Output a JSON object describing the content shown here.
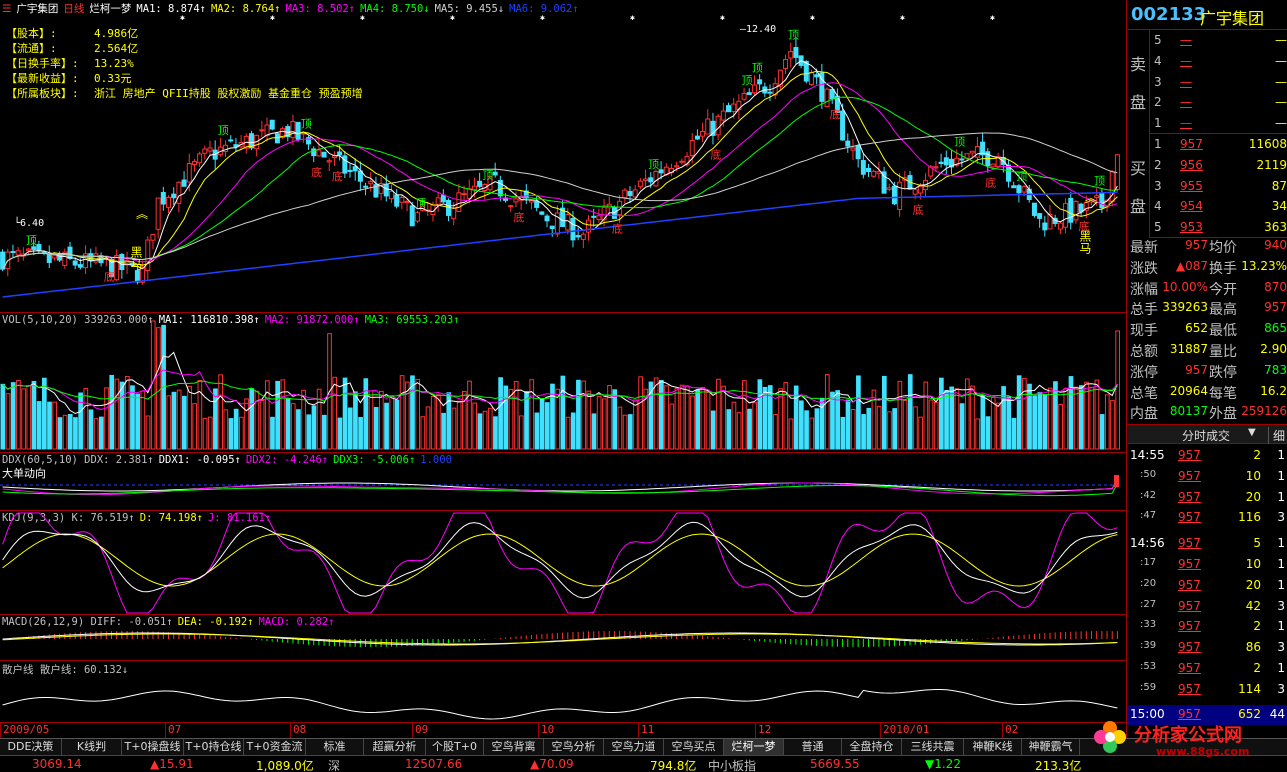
{
  "header": {
    "stock_name": "广宇集团",
    "period": "日线",
    "formula": "烂柯一梦",
    "ma_items": [
      {
        "label": "MA1: 8.874↑",
        "color": "#ffffff"
      },
      {
        "label": "MA2: 8.764↑",
        "color": "#ffff00"
      },
      {
        "label": "MA3: 8.502↑",
        "color": "#ff00ff"
      },
      {
        "label": "MA4: 8.750↓",
        "color": "#00ff00"
      },
      {
        "label": "MA5: 9.455↓",
        "color": "#d0d0d0"
      },
      {
        "label": "MA6: 9.062↑",
        "color": "#2040ff"
      }
    ]
  },
  "info_box": [
    {
      "label": "【股本】:",
      "value": "4.986亿"
    },
    {
      "label": "【流通】:",
      "value": "2.564亿"
    },
    {
      "label": "【日换手率】:",
      "value": "13.23%"
    },
    {
      "label": "【最新收益】:",
      "value": "0.33元"
    },
    {
      "label": "【所属板块】:",
      "value": "浙江  房地产  QFII持股  股权激励  基金重仓  预盈预增"
    }
  ],
  "price_labels": {
    "high": "12.40",
    "low": "6.40",
    "top": "顶",
    "bottom": "底",
    "dark_horse": "黑马"
  },
  "vol_header": [
    {
      "label": "VOL(5,10,20)  339263.000↑",
      "color": "#c0c0c0"
    },
    {
      "label": "MA1: 116810.398↑",
      "color": "#ffffff"
    },
    {
      "label": "MA2: 91872.000↑",
      "color": "#ff00ff"
    },
    {
      "label": "MA3: 69553.203↑",
      "color": "#00ff00"
    }
  ],
  "ddx_header": [
    {
      "label": "DDX(60,5,10)  DDX: 2.381↑",
      "color": "#c0c0c0"
    },
    {
      "label": "DDX1: -0.095↑",
      "color": "#ffffff"
    },
    {
      "label": "DDX2: -4.246↑",
      "color": "#ff00ff"
    },
    {
      "label": "DDX3: -5.006↑",
      "color": "#00ff00"
    },
    {
      "label": "1.000",
      "color": "#2040ff"
    }
  ],
  "ddx_note": "大单动向",
  "kdj_header": [
    {
      "label": "KDJ(9,3,3)  K: 76.519↑",
      "color": "#c0c0c0"
    },
    {
      "label": "D: 74.198↑",
      "color": "#ffff00"
    },
    {
      "label": "J: 81.161↑",
      "color": "#ff00ff"
    }
  ],
  "macd_header": [
    {
      "label": "MACD(26,12,9)  DIFF: -0.051↑",
      "color": "#c0c0c0"
    },
    {
      "label": "DEA: -0.192↑",
      "color": "#ffff00"
    },
    {
      "label": "MACD: 0.282↑",
      "color": "#ff00ff"
    }
  ],
  "sanhu_header": [
    {
      "label": "散户线  散户线: 60.132↓",
      "color": "#c0c0c0"
    }
  ],
  "months": [
    "2009/05",
    "07",
    "08",
    "09",
    "10",
    "11",
    "12",
    "2010/01",
    "02"
  ],
  "quote": {
    "code": "002133",
    "name": "广宇集团",
    "sell_label": "卖盘",
    "buy_label": "买盘",
    "asks": [
      {
        "n": "5",
        "p": "—",
        "v": "—"
      },
      {
        "n": "4",
        "p": "—",
        "v": "—"
      },
      {
        "n": "3",
        "p": "—",
        "v": "—"
      },
      {
        "n": "2",
        "p": "—",
        "v": "—"
      },
      {
        "n": "1",
        "p": "—",
        "v": "—"
      }
    ],
    "bids": [
      {
        "n": "1",
        "p": "957",
        "v": "11608"
      },
      {
        "n": "2",
        "p": "956",
        "v": "2119"
      },
      {
        "n": "3",
        "p": "955",
        "v": "87"
      },
      {
        "n": "4",
        "p": "954",
        "v": "34"
      },
      {
        "n": "5",
        "p": "953",
        "v": "363"
      }
    ],
    "stats": [
      {
        "l1": "最新",
        "v1": "957",
        "c1": "#ff3030",
        "l2": "均价",
        "v2": "940",
        "c2": "#ff3030"
      },
      {
        "l1": "涨跌",
        "v1": "▲087",
        "c1": "#ff3030",
        "l2": "换手",
        "v2": "13.23%",
        "c2": "#ffff00"
      },
      {
        "l1": "涨幅",
        "v1": "10.00%",
        "c1": "#ff3030",
        "l2": "今开",
        "v2": "870",
        "c2": "#ff3030"
      },
      {
        "l1": "总手",
        "v1": "339263",
        "c1": "#ffff00",
        "l2": "最高",
        "v2": "957",
        "c2": "#ff3030"
      },
      {
        "l1": "现手",
        "v1": "652",
        "c1": "#ffff00",
        "l2": "最低",
        "v2": "865",
        "c2": "#00ff00"
      },
      {
        "l1": "总额",
        "v1": "31887",
        "c1": "#ffff00",
        "l2": "量比",
        "v2": "2.90",
        "c2": "#ffff00"
      },
      {
        "l1": "涨停",
        "v1": "957",
        "c1": "#ff3030",
        "l2": "跌停",
        "v2": "783",
        "c2": "#00ff00"
      },
      {
        "l1": "总笔",
        "v1": "20964",
        "c1": "#ffff00",
        "l2": "每笔",
        "v2": "16.2",
        "c2": "#ffff00"
      },
      {
        "l1": "内盘",
        "v1": "80137",
        "c1": "#00ff00",
        "l2": "外盘",
        "v2": "259126",
        "c2": "#ff3030"
      }
    ],
    "ticks_tab": "分时成交",
    "detail_tab": "细",
    "ticks": [
      {
        "t": "14:55",
        "p": "957",
        "v": "2",
        "f": "1"
      },
      {
        "t": ":50",
        "p": "957",
        "v": "10",
        "f": "1"
      },
      {
        "t": ":42",
        "p": "957",
        "v": "20",
        "f": "1"
      },
      {
        "t": ":47",
        "p": "957",
        "v": "116",
        "f": "3"
      },
      {
        "t": "14:56",
        "p": "957",
        "v": "5",
        "f": "1"
      },
      {
        "t": ":17",
        "p": "957",
        "v": "10",
        "f": "1"
      },
      {
        "t": ":20",
        "p": "957",
        "v": "20",
        "f": "1"
      },
      {
        "t": ":27",
        "p": "957",
        "v": "42",
        "f": "3"
      },
      {
        "t": ":33",
        "p": "957",
        "v": "2",
        "f": "1"
      },
      {
        "t": ":39",
        "p": "957",
        "v": "86",
        "f": "3"
      },
      {
        "t": ":53",
        "p": "957",
        "v": "2",
        "f": "1"
      },
      {
        "t": ":59",
        "p": "957",
        "v": "114",
        "f": "3"
      },
      {
        "t": "15:00",
        "p": "957",
        "v": "652",
        "f": "44"
      }
    ]
  },
  "tabs": [
    "DDE决策",
    "K线判",
    "T+0操盘线",
    "T+0持仓线",
    "T+0资金流",
    "标准",
    "超赢分析",
    "个股T+0",
    "空鸟背离",
    "空鸟分析",
    "空鸟力道",
    "空鸟买点",
    "烂柯一梦",
    "普通",
    "全盘持仓",
    "三线共震",
    "神鞭K线",
    "神鞭霸气"
  ],
  "status": [
    {
      "text": "3069.14",
      "color": "#ff3030"
    },
    {
      "text": "▲15.91",
      "color": "#ff3030"
    },
    {
      "text": "1,089.0亿",
      "color": "#ffff00"
    },
    {
      "text": "深",
      "color": "#c0c0c0"
    },
    {
      "text": "12507.66",
      "color": "#ff3030"
    },
    {
      "text": "▲70.09",
      "color": "#ff3030"
    },
    {
      "text": "794.8亿",
      "color": "#ffff00"
    },
    {
      "text": "中小板指",
      "color": "#c0c0c0"
    },
    {
      "text": "5669.55",
      "color": "#ff3030"
    },
    {
      "text": "▼1.22",
      "color": "#00ff00"
    },
    {
      "text": "213.3亿",
      "color": "#ffff00"
    }
  ],
  "watermark": {
    "name": "分析家公式网",
    "url": "www.88gs.com"
  }
}
